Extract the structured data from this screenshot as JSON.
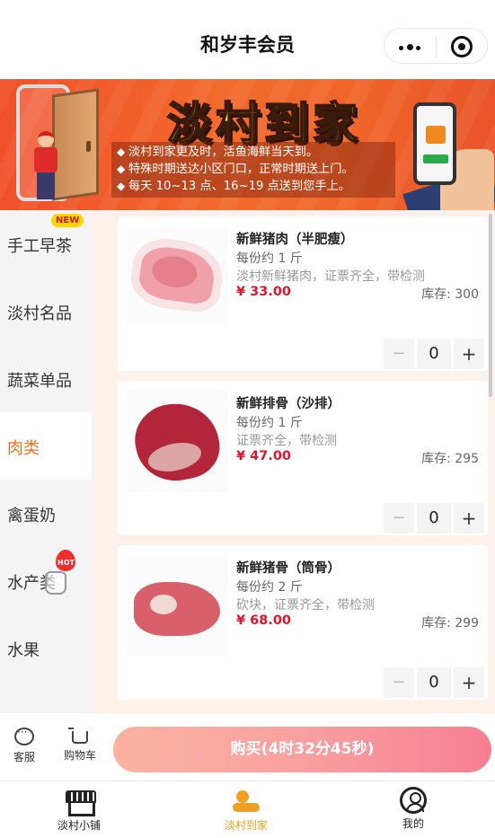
{
  "header": {
    "title": "和岁丰会员"
  },
  "banner": {
    "headline": "淡村到家",
    "notes": [
      "淡村到家更及时，活鱼海鲜当天到。",
      "特殊时期送达小区门口，正常时期送上门。",
      "每天 10~13 点、16~19 点送到您手上。"
    ]
  },
  "sidebar": {
    "items": [
      {
        "label": "手工早茶",
        "badge": "NEW"
      },
      {
        "label": "淡村名品"
      },
      {
        "label": "蔬菜单品"
      },
      {
        "label": "肉类",
        "active": true
      },
      {
        "label": "禽蛋奶"
      },
      {
        "label": "水产类",
        "badge": "HOT"
      },
      {
        "label": "水果"
      }
    ]
  },
  "products": [
    {
      "name": "新鲜猪肉（半肥瘦）",
      "spec": "每份约 1 斤",
      "desc": "淡村新鲜猪肉，证票齐全，带检测",
      "price": "¥ 33.00",
      "stock": "库存: 300",
      "qty": "0"
    },
    {
      "name": "新鲜排骨（沙排）",
      "spec": "每份约 1 斤",
      "desc": "证票齐全，带检测",
      "price": "¥ 47.00",
      "stock": "库存: 295",
      "qty": "0"
    },
    {
      "name": "新鲜猪骨（筒骨）",
      "spec": "每份约 2 斤",
      "desc": "砍块，证票齐全，带检测",
      "price": "¥ 68.00",
      "stock": "库存: 299",
      "qty": "0"
    }
  ],
  "stepper": {
    "minus": "−",
    "plus": "+"
  },
  "actionbar": {
    "service_label": "客服",
    "cart_label": "购物车",
    "buy_label": "购买(4时32分45秒)"
  },
  "tabbar": {
    "items": [
      {
        "label": "淡村小铺",
        "icon": "shop-icon"
      },
      {
        "label": "淡村到家",
        "icon": "delivery-icon",
        "active": true
      },
      {
        "label": "我的",
        "icon": "user-icon"
      }
    ]
  },
  "colors": {
    "accent": "#f2711c",
    "price": "#e0152b",
    "tab_active": "#f0a020"
  }
}
